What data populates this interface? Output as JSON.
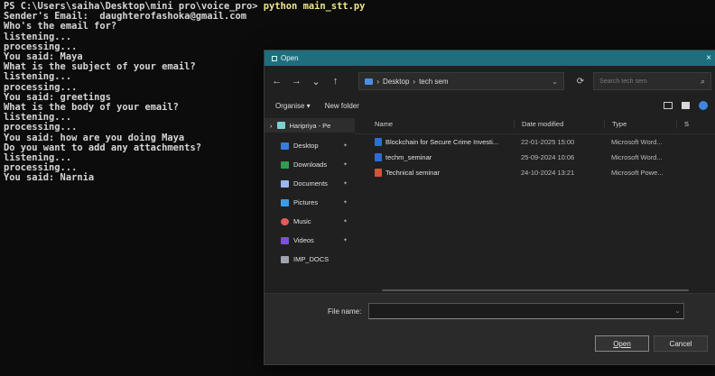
{
  "terminal": {
    "prompt": "PS C:\\Users\\saiha\\Desktop\\mini pro\\voice_pro>",
    "command": "python main_stt.py",
    "lines": [
      "Sender's Email:  daughterofashoka@gmail.com",
      "Who's the email for?",
      "listening...",
      "processing...",
      "You said: Maya",
      "What is the subject of your email?",
      "listening...",
      "processing...",
      "You said: greetings",
      "What is the body of your email?",
      "listening...",
      "processing...",
      "You said: how are you doing Maya",
      "Do you want to add any attachments?",
      "listening...",
      "processing...",
      "You said: Narnia"
    ]
  },
  "dialog": {
    "title": "Open",
    "close_glyph": "×",
    "nav": {
      "back": "←",
      "forward": "→",
      "up_chevron": "⌄",
      "up": "↑",
      "refresh": "⟳"
    },
    "address": {
      "sep1": "›",
      "part1": "Desktop",
      "sep2": "›",
      "part2": "tech sem",
      "chevron": "⌄"
    },
    "search": {
      "placeholder": "Search tech sem",
      "glyph": "⌕"
    },
    "commands": {
      "organise": "Organise ▾",
      "new_folder": "New folder"
    },
    "navpane": {
      "quick": "Haripriya - Pe",
      "items": [
        {
          "label": "Desktop",
          "pin": "✦"
        },
        {
          "label": "Downloads",
          "pin": "✦"
        },
        {
          "label": "Documents",
          "pin": "✦"
        },
        {
          "label": "Pictures",
          "pin": "✦"
        },
        {
          "label": "Music",
          "pin": "✦"
        },
        {
          "label": "Videos",
          "pin": "✦"
        },
        {
          "label": "IMP_DOCS",
          "pin": ""
        }
      ]
    },
    "columns": {
      "name": "Name",
      "date": "Date modified",
      "type": "Type",
      "size": "S"
    },
    "files": [
      {
        "name": "Blockchain for Secure Crime Investi...",
        "date": "22-01-2025 15:00",
        "type": "Microsoft Word...",
        "kind": "word"
      },
      {
        "name": "techm_seminar",
        "date": "25-09-2024 10:06",
        "type": "Microsoft Word...",
        "kind": "word"
      },
      {
        "name": "Technical seminar",
        "date": "24-10-2024 13:21",
        "type": "Microsoft Powe...",
        "kind": "ppt"
      }
    ],
    "footer": {
      "file_name_label": "File name:",
      "file_name_value": "",
      "chevron": "⌄",
      "open_button": "Open",
      "cancel_button": "Cancel"
    }
  }
}
